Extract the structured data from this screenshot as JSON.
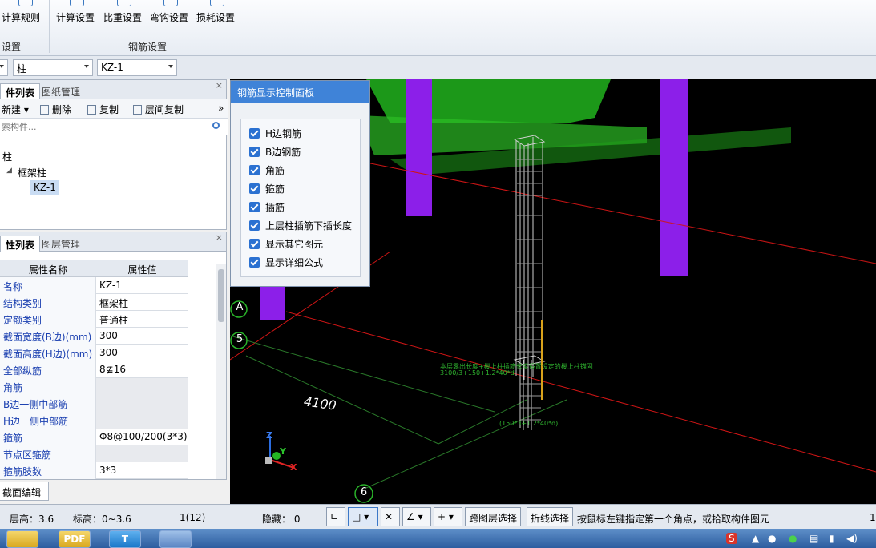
{
  "ribbon": {
    "buttons": [
      {
        "label": "计算规则",
        "icon": "calc-rules-icon"
      },
      {
        "label": "计算设置",
        "icon": "calc-settings-icon"
      },
      {
        "label": "比重设置",
        "icon": "weight-settings-icon"
      },
      {
        "label": "弯钩设置",
        "icon": "hook-settings-icon"
      },
      {
        "label": "损耗设置",
        "icon": "loss-settings-icon"
      }
    ],
    "group_left": "设置",
    "group_rebar": "钢筋设置"
  },
  "selector_bar": {
    "type": "柱",
    "component": "KZ-1"
  },
  "component_panel": {
    "tabs": [
      "件列表",
      "图纸管理"
    ],
    "close": "×",
    "toolbar": {
      "new": "新建",
      "delete": "删除",
      "copy": "复制",
      "floor_copy": "层间复制",
      "more": "»"
    },
    "search_placeholder": "索构件...",
    "tree": {
      "root": "柱",
      "group": "框架柱",
      "item": "KZ-1",
      "expand": "◢"
    }
  },
  "property_panel": {
    "tabs": [
      "性列表",
      "图层管理"
    ],
    "close": "×",
    "header": {
      "name": "属性名称",
      "value": "属性值"
    },
    "rows": [
      {
        "name": "名称",
        "value": "KZ-1"
      },
      {
        "name": "结构类别",
        "value": "框架柱"
      },
      {
        "name": "定额类别",
        "value": "普通柱"
      },
      {
        "name": "截面宽度(B边)(mm)",
        "value": "300"
      },
      {
        "name": "截面高度(H边)(mm)",
        "value": "300"
      },
      {
        "name": "全部纵筋",
        "value": "8⊈16"
      },
      {
        "name": "角筋",
        "value": ""
      },
      {
        "name": "B边一侧中部筋",
        "value": ""
      },
      {
        "name": "H边一侧中部筋",
        "value": ""
      },
      {
        "name": "箍筋",
        "value": "Φ8@100/200(3*3)"
      },
      {
        "name": "节点区箍筋",
        "value": ""
      },
      {
        "name": "箍筋肢数",
        "value": "3*3"
      }
    ],
    "section_edit": "截面编辑"
  },
  "control_panel": {
    "title": "钢筋显示控制面板",
    "options": [
      {
        "label": "H边钢筋",
        "checked": true
      },
      {
        "label": "B边钢筋",
        "checked": true
      },
      {
        "label": "角筋",
        "checked": true
      },
      {
        "label": "箍筋",
        "checked": true
      },
      {
        "label": "插筋",
        "checked": true
      },
      {
        "label": "上层柱插筋下插长度",
        "checked": true
      },
      {
        "label": "显示其它图元",
        "checked": true
      },
      {
        "label": "显示详细公式",
        "checked": true
      }
    ]
  },
  "viewport": {
    "axis_a": "A",
    "axis_5": "5",
    "axis_6": "6",
    "dimension": "4100",
    "annotation_line1": "本层露出长度+楼上柱插筋长度设置设定的楼上柱锚固",
    "annotation_line2": "3100/3+150+1.2*40*d",
    "annotation_bottom": "(150*3+1.2*40*d)",
    "axes": {
      "z": "Z",
      "y": "Y",
      "x": "X"
    },
    "colors": {
      "purple": "#8a1ee6",
      "green": "#22b422",
      "red": "#d01010",
      "grid_green": "#2a7a2a"
    }
  },
  "status_bar": {
    "floor_height": "层高：3.6",
    "elevation": "标高：0~3.6",
    "count": "1(12)",
    "hidden": "隐藏： 0",
    "cross_floor": "跨图层选择",
    "polyline_select": "折线选择",
    "hint": "按鼠标左键指定第一个角点，或拾取构件图元",
    "right_num": "1"
  },
  "taskbar": {
    "apps": [
      "",
      "PDF",
      "T",
      ""
    ]
  }
}
